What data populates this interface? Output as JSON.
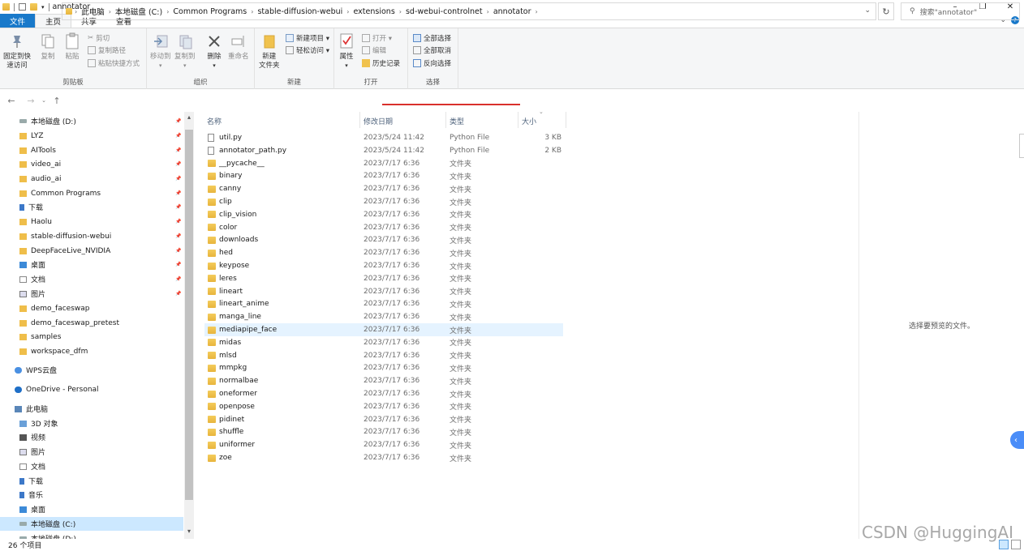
{
  "window": {
    "title": "annotator",
    "controls": [
      "–",
      "❐",
      "✕"
    ]
  },
  "ribbon_tabs": [
    {
      "label": "文件",
      "style": "file"
    },
    {
      "label": "主页",
      "style": "active"
    },
    {
      "label": "共享",
      "style": ""
    },
    {
      "label": "查看",
      "style": ""
    }
  ],
  "ribbon": {
    "clipboard": {
      "label": "剪贴板",
      "pin_label_1": "固定到快",
      "pin_label_2": "速访问",
      "copy": "复制",
      "paste": "粘贴",
      "cut": "剪切",
      "copy_path": "复制路径",
      "paste_shortcut": "粘贴快捷方式"
    },
    "organize": {
      "label": "组织",
      "move_to": "移动到",
      "copy_to": "复制到",
      "delete": "删除",
      "rename": "重命名"
    },
    "new": {
      "label": "新建",
      "new_folder_1": "新建",
      "new_folder_2": "文件夹",
      "new_item": "新建项目 ▾",
      "easy_access": "轻松访问 ▾"
    },
    "open": {
      "label": "打开",
      "properties": "属性",
      "open": "打开 ▾",
      "edit": "编辑",
      "history": "历史记录"
    },
    "select": {
      "label": "选择",
      "select_all": "全部选择",
      "select_none": "全部取消",
      "invert": "反向选择"
    }
  },
  "address": {
    "crumbs": [
      "此电脑",
      "本地磁盘 (C:)",
      "Common Programs",
      "stable-diffusion-webui",
      "extensions",
      "sd-webui-controlnet",
      "annotator"
    ],
    "search_placeholder": "搜索\"annotator\""
  },
  "nav": [
    {
      "label": "本地磁盘 (D:)",
      "icon": "drive-icon",
      "pinned": true
    },
    {
      "label": "LYZ",
      "icon": "folder-icon",
      "pinned": true
    },
    {
      "label": "AITools",
      "icon": "folder-icon",
      "pinned": true
    },
    {
      "label": "video_ai",
      "icon": "folder-icon",
      "pinned": true
    },
    {
      "label": "audio_ai",
      "icon": "folder-icon",
      "pinned": true
    },
    {
      "label": "Common Programs",
      "icon": "folder-icon",
      "pinned": true
    },
    {
      "label": "下载",
      "icon": "download-icon",
      "pinned": true
    },
    {
      "label": "Haolu",
      "icon": "folder-icon",
      "pinned": true
    },
    {
      "label": "stable-diffusion-webui",
      "icon": "folder-icon",
      "pinned": true
    },
    {
      "label": "DeepFaceLive_NVIDIA",
      "icon": "folder-icon",
      "pinned": true
    },
    {
      "label": "桌面",
      "icon": "desktop-icon",
      "pinned": true
    },
    {
      "label": "文档",
      "icon": "document-icon",
      "pinned": true
    },
    {
      "label": "图片",
      "icon": "picture-icon",
      "pinned": true
    },
    {
      "label": "demo_faceswap",
      "icon": "folder-icon",
      "pinned": false
    },
    {
      "label": "demo_faceswap_pretest",
      "icon": "folder-icon",
      "pinned": false
    },
    {
      "label": "samples",
      "icon": "folder-icon",
      "pinned": false
    },
    {
      "label": "workspace_dfm",
      "icon": "folder-icon",
      "pinned": false
    },
    {
      "label": "WPS云盘",
      "icon": "cloud-icon",
      "pinned": false,
      "group": true
    },
    {
      "label": "OneDrive - Personal",
      "icon": "onedrive-icon",
      "pinned": false,
      "group": true
    },
    {
      "label": "此电脑",
      "icon": "computer-icon",
      "pinned": false,
      "group": true
    },
    {
      "label": "3D 对象",
      "icon": "3d-objects-icon",
      "pinned": false
    },
    {
      "label": "视频",
      "icon": "video-icon",
      "pinned": false
    },
    {
      "label": "图片",
      "icon": "picture-icon",
      "pinned": false
    },
    {
      "label": "文档",
      "icon": "document-icon",
      "pinned": false
    },
    {
      "label": "下载",
      "icon": "download-icon",
      "pinned": false
    },
    {
      "label": "音乐",
      "icon": "music-icon",
      "pinned": false
    },
    {
      "label": "桌面",
      "icon": "desktop-icon",
      "pinned": false
    },
    {
      "label": "本地磁盘 (C:)",
      "icon": "drive-icon",
      "pinned": false,
      "selected": true
    },
    {
      "label": "本地磁盘 (D:)",
      "icon": "drive-icon",
      "pinned": false
    }
  ],
  "columns": {
    "name": "名称",
    "date": "修改日期",
    "type": "类型",
    "size": "大小"
  },
  "files": [
    {
      "name": "util.py",
      "date": "2023/5/24 11:42",
      "type": "Python File",
      "size": "3 KB",
      "kind": "file"
    },
    {
      "name": "annotator_path.py",
      "date": "2023/5/24 11:42",
      "type": "Python File",
      "size": "2 KB",
      "kind": "file"
    },
    {
      "name": "__pycache__",
      "date": "2023/7/17 6:36",
      "type": "文件夹",
      "size": "",
      "kind": "folder"
    },
    {
      "name": "binary",
      "date": "2023/7/17 6:36",
      "type": "文件夹",
      "size": "",
      "kind": "folder"
    },
    {
      "name": "canny",
      "date": "2023/7/17 6:36",
      "type": "文件夹",
      "size": "",
      "kind": "folder"
    },
    {
      "name": "clip",
      "date": "2023/7/17 6:36",
      "type": "文件夹",
      "size": "",
      "kind": "folder"
    },
    {
      "name": "clip_vision",
      "date": "2023/7/17 6:36",
      "type": "文件夹",
      "size": "",
      "kind": "folder"
    },
    {
      "name": "color",
      "date": "2023/7/17 6:36",
      "type": "文件夹",
      "size": "",
      "kind": "folder"
    },
    {
      "name": "downloads",
      "date": "2023/7/17 6:36",
      "type": "文件夹",
      "size": "",
      "kind": "folder"
    },
    {
      "name": "hed",
      "date": "2023/7/17 6:36",
      "type": "文件夹",
      "size": "",
      "kind": "folder"
    },
    {
      "name": "keypose",
      "date": "2023/7/17 6:36",
      "type": "文件夹",
      "size": "",
      "kind": "folder"
    },
    {
      "name": "leres",
      "date": "2023/7/17 6:36",
      "type": "文件夹",
      "size": "",
      "kind": "folder"
    },
    {
      "name": "lineart",
      "date": "2023/7/17 6:36",
      "type": "文件夹",
      "size": "",
      "kind": "folder"
    },
    {
      "name": "lineart_anime",
      "date": "2023/7/17 6:36",
      "type": "文件夹",
      "size": "",
      "kind": "folder"
    },
    {
      "name": "manga_line",
      "date": "2023/7/17 6:36",
      "type": "文件夹",
      "size": "",
      "kind": "folder"
    },
    {
      "name": "mediapipe_face",
      "date": "2023/7/17 6:36",
      "type": "文件夹",
      "size": "",
      "kind": "folder",
      "hover": true
    },
    {
      "name": "midas",
      "date": "2023/7/17 6:36",
      "type": "文件夹",
      "size": "",
      "kind": "folder"
    },
    {
      "name": "mlsd",
      "date": "2023/7/17 6:36",
      "type": "文件夹",
      "size": "",
      "kind": "folder"
    },
    {
      "name": "mmpkg",
      "date": "2023/7/17 6:36",
      "type": "文件夹",
      "size": "",
      "kind": "folder"
    },
    {
      "name": "normalbae",
      "date": "2023/7/17 6:36",
      "type": "文件夹",
      "size": "",
      "kind": "folder"
    },
    {
      "name": "oneformer",
      "date": "2023/7/17 6:36",
      "type": "文件夹",
      "size": "",
      "kind": "folder"
    },
    {
      "name": "openpose",
      "date": "2023/7/17 6:36",
      "type": "文件夹",
      "size": "",
      "kind": "folder"
    },
    {
      "name": "pidinet",
      "date": "2023/7/17 6:36",
      "type": "文件夹",
      "size": "",
      "kind": "folder"
    },
    {
      "name": "shuffle",
      "date": "2023/7/17 6:36",
      "type": "文件夹",
      "size": "",
      "kind": "folder"
    },
    {
      "name": "uniformer",
      "date": "2023/7/17 6:36",
      "type": "文件夹",
      "size": "",
      "kind": "folder"
    },
    {
      "name": "zoe",
      "date": "2023/7/17 6:36",
      "type": "文件夹",
      "size": "",
      "kind": "folder"
    }
  ],
  "preview": {
    "text": "选择要预览的文件。"
  },
  "status": {
    "count": "26 个项目"
  },
  "watermark": "CSDN @HuggingAI",
  "colors": {
    "file_tab": "#1979ca",
    "selection": "#cce8ff",
    "hover": "#e5f3ff",
    "underline": "#d9302c"
  }
}
